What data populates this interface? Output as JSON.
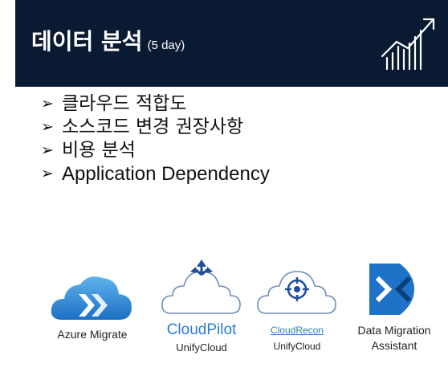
{
  "header": {
    "title": "데이터 분석",
    "subtitle": "(5 day)",
    "icon": "growth-chart-icon",
    "background": "#0b1a33"
  },
  "bullets": [
    "클라우드 적합도",
    "소스코드 변경 권장사항",
    "비용 분석",
    "Application Dependency"
  ],
  "tools": [
    {
      "name": "Azure Migrate",
      "icon": "azure-migrate-cloud-icon"
    },
    {
      "name": "CloudPilot",
      "vendor": "UnifyCloud",
      "icon": "cloudpilot-icon"
    },
    {
      "name": "CloudRecon",
      "vendor": "UnifyCloud",
      "icon": "cloudrecon-icon"
    },
    {
      "name": "Data Migration",
      "name2": "Assistant",
      "icon": "data-migration-assistant-icon"
    }
  ],
  "colors": {
    "accent_blue": "#2b7bd6",
    "dma_blue": "#1e73c8"
  }
}
